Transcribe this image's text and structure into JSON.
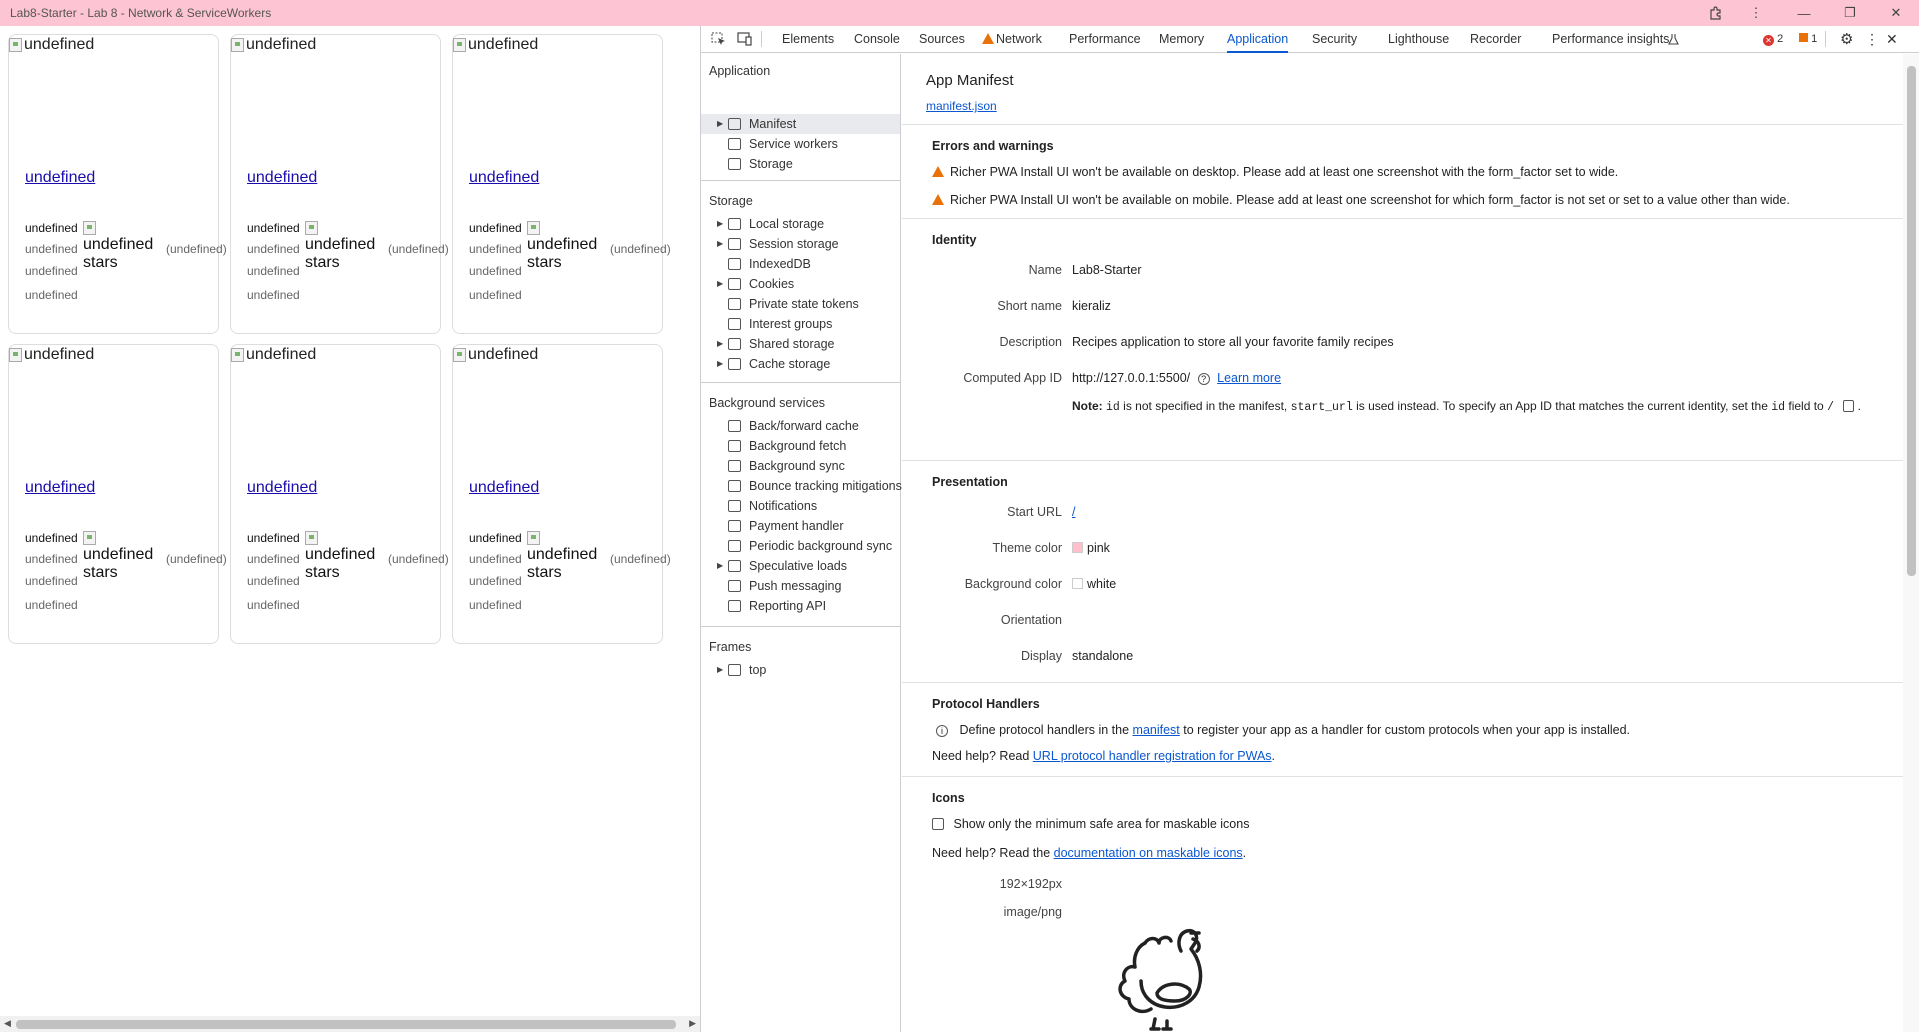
{
  "window": {
    "title": "Lab8-Starter - Lab 8 - Network & ServiceWorkers"
  },
  "page": {
    "cards": [
      {
        "img_alt": "undefined",
        "title": "undefined",
        "org": "undefined",
        "rating_alt": "undefined stars",
        "rating_count": "(undefined)",
        "line2": "undefined",
        "line3": "undefined",
        "line4": "undefined"
      },
      {
        "img_alt": "undefined",
        "title": "undefined",
        "org": "undefined",
        "rating_alt": "undefined stars",
        "rating_count": "(undefined)",
        "line2": "undefined",
        "line3": "undefined",
        "line4": "undefined"
      },
      {
        "img_alt": "undefined",
        "title": "undefined",
        "org": "undefined",
        "rating_alt": "undefined stars",
        "rating_count": "(undefined)",
        "line2": "undefined",
        "line3": "undefined",
        "line4": "undefined"
      },
      {
        "img_alt": "undefined",
        "title": "undefined",
        "org": "undefined",
        "rating_alt": "undefined stars",
        "rating_count": "(undefined)",
        "line2": "undefined",
        "line3": "undefined",
        "line4": "undefined"
      },
      {
        "img_alt": "undefined",
        "title": "undefined",
        "org": "undefined",
        "rating_alt": "undefined stars",
        "rating_count": "(undefined)",
        "line2": "undefined",
        "line3": "undefined",
        "line4": "undefined"
      },
      {
        "img_alt": "undefined",
        "title": "undefined",
        "org": "undefined",
        "rating_alt": "undefined stars",
        "rating_count": "(undefined)",
        "line2": "undefined",
        "line3": "undefined",
        "line4": "undefined"
      }
    ]
  },
  "devtools": {
    "tabs": [
      "Elements",
      "Console",
      "Sources",
      "Network",
      "Performance",
      "Memory",
      "Application",
      "Security",
      "Lighthouse",
      "Recorder",
      "Performance insights"
    ],
    "active_tab": "Application",
    "errors_count": "2",
    "issues_count": "1",
    "sidebar": {
      "application_heading": "Application",
      "application_items": [
        "Manifest",
        "Service workers",
        "Storage"
      ],
      "storage_heading": "Storage",
      "storage_items": [
        "Local storage",
        "Session storage",
        "IndexedDB",
        "Cookies",
        "Private state tokens",
        "Interest groups",
        "Shared storage",
        "Cache storage"
      ],
      "background_heading": "Background services",
      "background_items": [
        "Back/forward cache",
        "Background fetch",
        "Background sync",
        "Bounce tracking mitigations",
        "Notifications",
        "Payment handler",
        "Periodic background sync",
        "Speculative loads",
        "Push messaging",
        "Reporting API"
      ],
      "frames_heading": "Frames",
      "frames_items": [
        "top"
      ]
    },
    "manifest": {
      "heading": "App Manifest",
      "file_link": "manifest.json",
      "errors_title": "Errors and warnings",
      "warnings": [
        "Richer PWA Install UI won't be available on desktop. Please add at least one screenshot with the form_factor set to wide.",
        "Richer PWA Install UI won't be available on mobile. Please add at least one screenshot for which form_factor is not set or set to a value other than wide."
      ],
      "identity_title": "Identity",
      "name_label": "Name",
      "name_value": "Lab8-Starter",
      "short_name_label": "Short name",
      "short_name_value": "kieraliz",
      "description_label": "Description",
      "description_value": "Recipes application to store all your favorite family recipes",
      "app_id_label": "Computed App ID",
      "app_id_value": "http://127.0.0.1:5500/",
      "learn_more": "Learn more",
      "note_bold": "Note:",
      "note_code_id": "id",
      "note_text1": "is not specified in the manifest,",
      "note_code_start": "start_url",
      "note_text2": "is used instead. To specify an App ID that matches the current identity, set the",
      "note_code_id2": "id",
      "note_text3": "field to",
      "note_code_slash": "/",
      "presentation_title": "Presentation",
      "start_url_label": "Start URL",
      "start_url_value": "/",
      "theme_color_label": "Theme color",
      "theme_color_value": "pink",
      "theme_color_hex": "#ffc0cb",
      "bg_color_label": "Background color",
      "bg_color_value": "white",
      "bg_color_hex": "#ffffff",
      "orientation_label": "Orientation",
      "orientation_value": "",
      "display_label": "Display",
      "display_value": "standalone",
      "protocol_title": "Protocol Handlers",
      "protocol_text1": "Define protocol handlers in the",
      "protocol_link": "manifest",
      "protocol_text2": "to register your app as a handler for custom protocols when your app is installed.",
      "protocol_help": "Need help? Read",
      "protocol_help_link": "URL protocol handler registration for PWAs",
      "icons_title": "Icons",
      "icons_checkbox": "Show only the minimum safe area for maskable icons",
      "icons_help": "Need help? Read the",
      "icons_help_link": "documentation on maskable icons",
      "icon_size": "192×192px",
      "icon_type": "image/png"
    }
  }
}
